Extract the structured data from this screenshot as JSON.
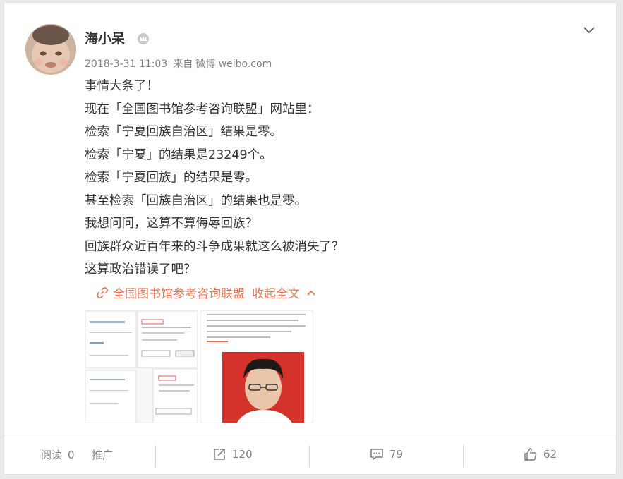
{
  "post": {
    "author": "海小呆",
    "meta": {
      "date": "2018-3-31 11:03",
      "from_label": "来自",
      "source": "微博 weibo.com"
    },
    "lines": [
      "事情大条了！",
      "现在「全国图书馆参考咨询联盟」网站里：",
      "检索「宁夏回族自治区」结果是零。",
      "检索「宁夏」的结果是23249个。",
      "检索「宁夏回族」的结果是零。",
      "甚至检索「回族自治区」的结果也是零。",
      "我想问问，这算不算侮辱回族？",
      "回族群众近百年来的斗争成果就这么被消失了？",
      "这算政治错误了吧？"
    ],
    "link_text": "全国图书馆参考咨询联盟",
    "collapse_label": "收起全文"
  },
  "footer": {
    "read_label": "阅读",
    "read_count": "0",
    "promote_label": "推广",
    "repost_count": "120",
    "comment_count": "79",
    "like_count": "62"
  },
  "icons": [
    "avatar",
    "crown-icon",
    "chevron-down-icon",
    "link-icon",
    "chevron-up-icon",
    "repost-icon",
    "comment-icon",
    "like-icon"
  ],
  "colors": {
    "accent": "#eb7350",
    "text": "#333333",
    "meta": "#808080"
  }
}
